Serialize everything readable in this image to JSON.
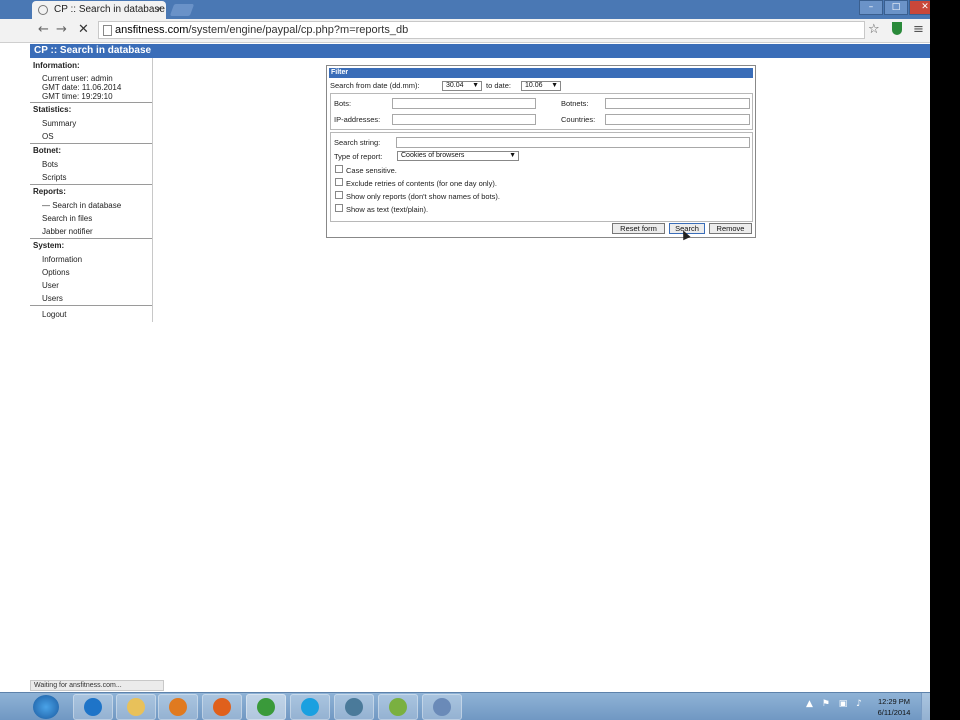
{
  "browser": {
    "tab_title": "CP :: Search in database",
    "tab_close": "×",
    "url_host": "ansfitness.com",
    "url_path": "/system/engine/paypal/cp.php?m=reports_db",
    "back": "←",
    "forward": "→",
    "stop": "✕",
    "star": "☆",
    "menu": "≡",
    "win_min": "–",
    "win_max": "□",
    "win_close": "✕"
  },
  "page": {
    "header": "CP :: Search in database",
    "status": "Waiting for ansfitness.com..."
  },
  "sidebar": {
    "information": {
      "title": "Information:",
      "current_user": "Current user: admin",
      "gmt_date": "GMT date: 11.06.2014",
      "gmt_time": "GMT time: 19:29:10"
    },
    "statistics": {
      "title": "Statistics:",
      "items": [
        "Summary",
        "OS"
      ]
    },
    "botnet": {
      "title": "Botnet:",
      "items": [
        "Bots",
        "Scripts"
      ]
    },
    "reports": {
      "title": "Reports:",
      "items": [
        "— Search in database",
        "Search in files",
        "Jabber notifier"
      ]
    },
    "system": {
      "title": "System:",
      "items": [
        "Information",
        "Options",
        "User",
        "Users"
      ]
    },
    "logout": "Logout"
  },
  "filter": {
    "title": "Filter",
    "date_from_label": "Search from date (dd.mm):",
    "date_from": "30.04",
    "date_to_label": "to date:",
    "date_to": "10.06",
    "bots_label": "Bots:",
    "botnets_label": "Botnets:",
    "ip_label": "IP-addresses:",
    "countries_label": "Countries:",
    "search_string_label": "Search string:",
    "report_type_label": "Type of report:",
    "report_type": "Cookies of browsers",
    "checkboxes": [
      "Case sensitive.",
      "Exclude retries of contents (for one day only).",
      "Show only reports (don't show names of bots).",
      "Show as text (text/plain)."
    ],
    "reset_button": "Reset form",
    "search_button": "Search",
    "remove_button": "Remove",
    "dropdown_arrow": "▼"
  },
  "taskbar": {
    "tray": "▲ ⚑ ▣ ♪",
    "time": "12:29 PM",
    "date": "6/11/2014",
    "icons": [
      {
        "name": "internet-explorer-icon",
        "color": "#1e74c8"
      },
      {
        "name": "file-explorer-icon",
        "color": "#e8c15a"
      },
      {
        "name": "media-player-icon",
        "color": "#e07a20"
      },
      {
        "name": "firefox-icon",
        "color": "#e0601c"
      },
      {
        "name": "chrome-icon",
        "color": "#3a9a3a"
      },
      {
        "name": "skype-icon",
        "color": "#1aa0e0"
      },
      {
        "name": "network-icon",
        "color": "#4a7a9a"
      },
      {
        "name": "utility-icon",
        "color": "#7ab040"
      },
      {
        "name": "tool-icon",
        "color": "#6a8ab8"
      }
    ]
  }
}
